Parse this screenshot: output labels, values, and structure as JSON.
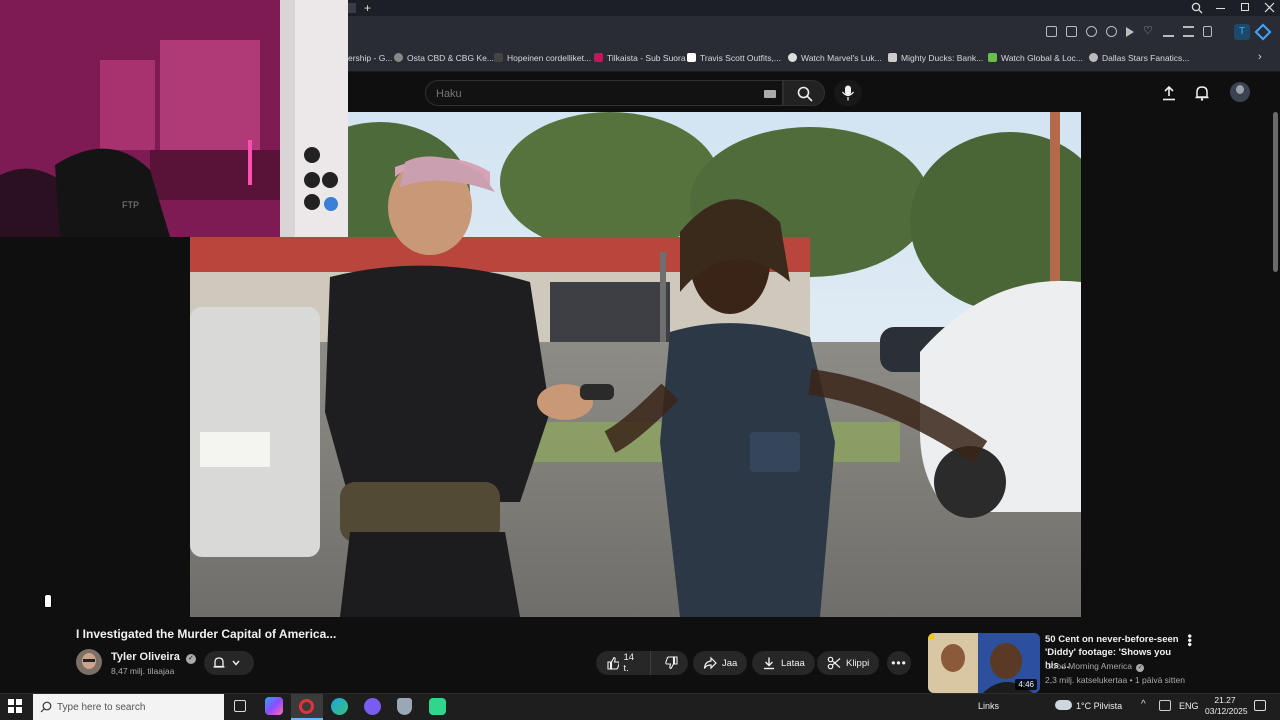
{
  "bookmarks": [
    {
      "label": "ership - G...",
      "color": "#3a3a3a"
    },
    {
      "label": "Osta CBD & CBG Ke...",
      "color": "#888888"
    },
    {
      "label": "Hopeinen cordelliket...",
      "color": "#444444"
    },
    {
      "label": "Tilkaista - Sub Suora",
      "color": "#c2185b"
    },
    {
      "label": "Travis Scott Outfits,...",
      "color": "#ffffff"
    },
    {
      "label": "Watch Marvel's Luk...",
      "color": "#dddddd"
    },
    {
      "label": "Mighty Ducks: Bank...",
      "color": "#cccccc"
    },
    {
      "label": "Watch Global & Loc...",
      "color": "#6abf4b"
    },
    {
      "label": "Dallas Stars Fanatics...",
      "color": "#bbbbbb"
    }
  ],
  "search": {
    "placeholder": "Haku"
  },
  "video": {
    "title": "I Investigated the Murder Capital of America..."
  },
  "channel": {
    "name": "Tyler Oliveira",
    "subscribers": "8,47 milj. tilaajaa"
  },
  "actions": {
    "like_count": "14 t.",
    "share": "Jaa",
    "download": "Lataa",
    "clip": "Klippi"
  },
  "recommended": {
    "title": "50 Cent on never-before-seen 'Diddy' footage: 'Shows you his ...",
    "channel": "Good Morning America",
    "meta": "2,3 milj. katselukertaa • 1 päivä sitten",
    "duration": "4:46"
  },
  "taskbar": {
    "search_placeholder": "Type here to search",
    "links": "Links",
    "weather": "1°C  Pilvista",
    "lang": "ENG",
    "time": "21.27",
    "date": "03/12/2025"
  },
  "colors": {
    "accent": "#3ea6ff",
    "bg": "#0f0f0f",
    "pill": "#272727"
  }
}
